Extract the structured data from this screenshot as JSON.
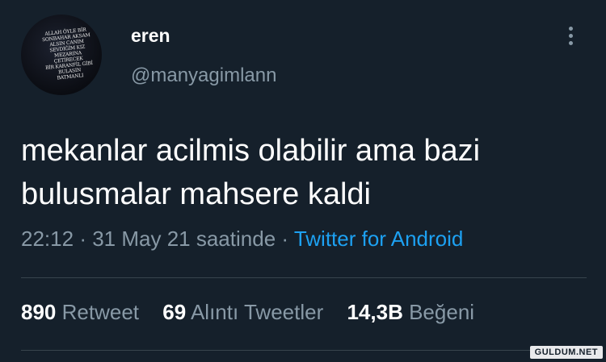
{
  "tweet": {
    "display_name": "eren",
    "handle": "@manyagimlann",
    "text_line1": "mekanlar acilmis olabilir ama bazi",
    "text_line2": "bulusmalar mahsere kaldi",
    "time": "22:12",
    "date": "31 May 21 saatinde",
    "separator": "·",
    "source": "Twitter for Android",
    "retweet_count": "890",
    "retweet_label": "Retweet",
    "quote_count": "69",
    "quote_label": "Alıntı Tweetler",
    "like_count": "14,3B",
    "like_label": "Beğeni"
  },
  "avatar": {
    "shirt_text": "ALLAH ÖYLE BİR\nSONBAHAR AKSAM\nALSIN CANIM\nSEVDİĞİM KIZ\nMEZARINA\nÇETİRECEK\nBİR KARANFİL GİBİ\nBULASIN\nBATMANLI"
  },
  "watermark": "GULDUM.NET",
  "colors": {
    "background": "#15202b",
    "secondary_text": "#8899a6",
    "link": "#1da1f2",
    "divider": "#38444d"
  }
}
